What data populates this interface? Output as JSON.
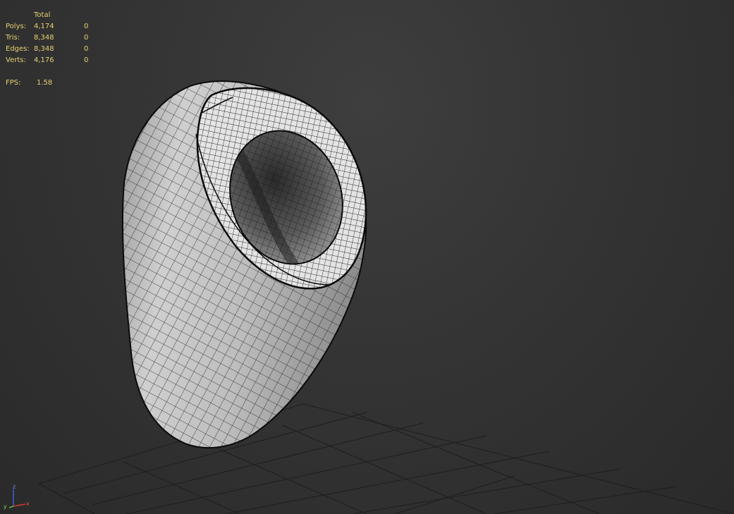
{
  "stats": {
    "column_header": "Total",
    "rows": [
      {
        "label": "Polys:",
        "total": "4,174",
        "selected": "0"
      },
      {
        "label": "Tris:",
        "total": "8,348",
        "selected": "0"
      },
      {
        "label": "Edges:",
        "total": "8,348",
        "selected": "0"
      },
      {
        "label": "Verts:",
        "total": "4,176",
        "selected": "0"
      }
    ],
    "fps_label": "FPS:",
    "fps_value": "1.58"
  },
  "gizmo": {
    "z_label": "z",
    "y_label": "y",
    "x_label": "x"
  },
  "colors": {
    "stats_text": "#e6d072",
    "viewport_bg": "#343434",
    "mesh_fill": "#c4c4c4",
    "wireframe": "#111111",
    "grid": "#1e1e1e",
    "axis_x": "#d33b2e",
    "axis_y": "#58c23e",
    "axis_z": "#3c5fd6"
  }
}
